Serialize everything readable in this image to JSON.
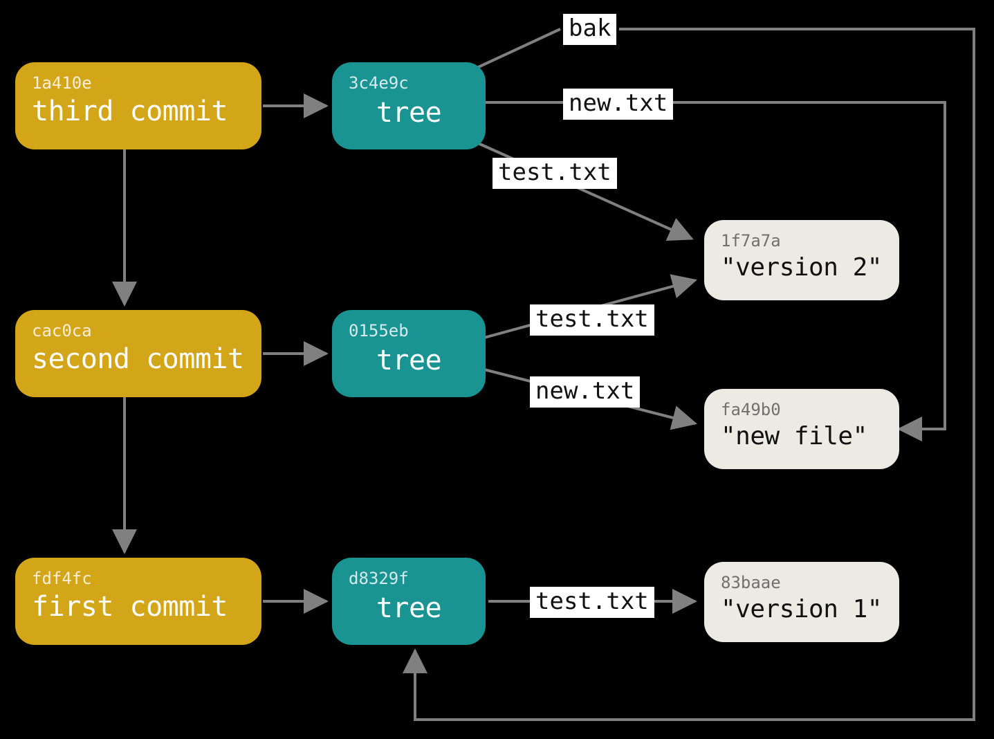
{
  "colors": {
    "commit": "#d3a518",
    "tree": "#1a9393",
    "blob": "#ebebe4",
    "arrow": "#808080",
    "edge_label_bg": "#ffffff",
    "background": "#000000"
  },
  "commits": {
    "third": {
      "hash": "1a410e",
      "label": "third commit"
    },
    "second": {
      "hash": "cac0ca",
      "label": "second commit"
    },
    "first": {
      "hash": "fdf4fc",
      "label": "first commit"
    }
  },
  "trees": {
    "t3": {
      "hash": "3c4e9c",
      "label": "tree"
    },
    "t2": {
      "hash": "0155eb",
      "label": "tree"
    },
    "t1": {
      "hash": "d8329f",
      "label": "tree"
    }
  },
  "blobs": {
    "v2": {
      "hash": "1f7a7a",
      "content": "\"version 2\""
    },
    "nf": {
      "hash": "fa49b0",
      "content": "\"new file\""
    },
    "v1": {
      "hash": "83baae",
      "content": "\"version 1\""
    }
  },
  "edge_labels": {
    "bak": "bak",
    "newtxt": "new.txt",
    "testtxt": "test.txt"
  }
}
